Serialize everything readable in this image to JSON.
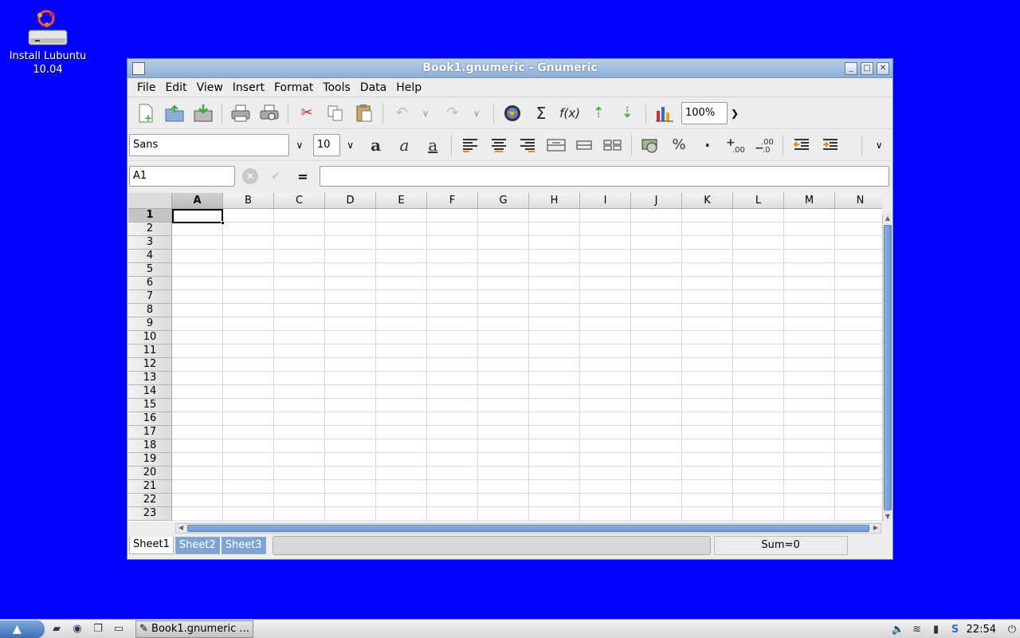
{
  "desktop": {
    "icon_label_line1": "Install Lubuntu",
    "icon_label_line2": "10.04",
    "background": "#0000ff"
  },
  "window": {
    "title": "Book1.gnumeric - Gnumeric",
    "buttons": [
      "minimize-icon",
      "maximize-icon",
      "close-icon"
    ]
  },
  "menubar": {
    "items": [
      "File",
      "Edit",
      "View",
      "Insert",
      "Format",
      "Tools",
      "Data",
      "Help"
    ]
  },
  "toolbar": {
    "zoom": "100%"
  },
  "format_toolbar": {
    "font_name": "Sans",
    "font_size": "10",
    "bold_glyph": "a",
    "italic_glyph": "a",
    "underline_glyph": "a",
    "percent_glyph": "%",
    "thousands_glyph": "·"
  },
  "formula_bar": {
    "cell_ref": "A1",
    "equals": "=",
    "content": ""
  },
  "grid": {
    "columns": [
      "A",
      "B",
      "C",
      "D",
      "E",
      "F",
      "G",
      "H",
      "I",
      "J",
      "K",
      "L",
      "M",
      "N"
    ],
    "rows": [
      "1",
      "2",
      "3",
      "4",
      "5",
      "6",
      "7",
      "8",
      "9",
      "10",
      "11",
      "12",
      "13",
      "14",
      "15",
      "16",
      "17",
      "18",
      "19",
      "20",
      "21",
      "22",
      "23"
    ],
    "active_column": "A",
    "active_row": "1"
  },
  "status": {
    "sheets": [
      "Sheet1",
      "Sheet2",
      "Sheet3"
    ],
    "active_sheet": "Sheet1",
    "sum": "Sum=0"
  },
  "taskbar": {
    "task_label": "Book1.gnumeric ...",
    "clock": "22:54"
  }
}
